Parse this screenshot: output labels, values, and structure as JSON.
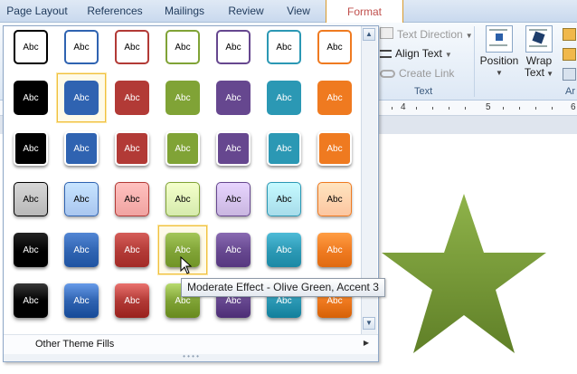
{
  "tabs": [
    {
      "label": "Page Layout",
      "active": false
    },
    {
      "label": "References",
      "active": false
    },
    {
      "label": "Mailings",
      "active": false
    },
    {
      "label": "Review",
      "active": false
    },
    {
      "label": "View",
      "active": false
    },
    {
      "label": "Format",
      "active": true
    }
  ],
  "ribbon": {
    "text_direction": "Text Direction",
    "align_text": "Align Text",
    "create_link": "Create Link",
    "text_group": "Text",
    "position": "Position",
    "wrap_text_line1": "Wrap",
    "wrap_text_line2": "Text",
    "arrange_group": "Ar"
  },
  "ruler_numbers": [
    "4",
    "5",
    "6"
  ],
  "gallery": {
    "swatch_label": "Abc",
    "rows": [
      {
        "style": "outline"
      },
      {
        "style": "flat"
      },
      {
        "style": "flat-shadow"
      },
      {
        "style": "light-gradient"
      },
      {
        "style": "moderate"
      },
      {
        "style": "intense"
      }
    ],
    "colors": [
      "#000000",
      "#2f63b1",
      "#b23a36",
      "#80a336",
      "#66478f",
      "#2b98b4",
      "#ef7a20"
    ],
    "light_colors": [
      "#b8b8b8",
      "#a9c6ef",
      "#f0a3a1",
      "#d6ebad",
      "#c9b6e0",
      "#a7dcea",
      "#fcc6a1"
    ],
    "selected": {
      "row": 1,
      "col": 1
    },
    "hovered": {
      "row": 4,
      "col": 3
    },
    "footer_label": "Other Theme Fills"
  },
  "tooltip": "Moderate Effect - Olive Green, Accent 3",
  "shape": {
    "type": "star",
    "color": "#7ea23a"
  }
}
